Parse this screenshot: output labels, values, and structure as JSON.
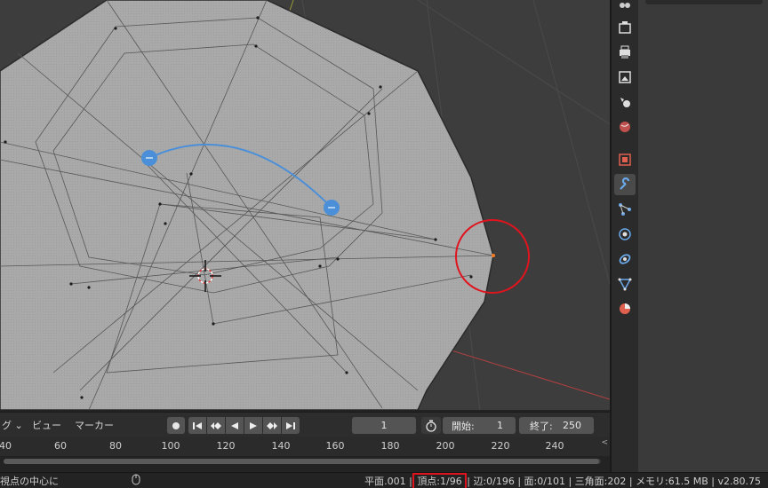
{
  "timeline": {
    "playback_menu": "グ",
    "view_menu": "ビュー",
    "marker_menu": "マーカー",
    "current_frame": "1",
    "start_label": "開始:",
    "start_value": "1",
    "end_label": "終了:",
    "end_value": "250",
    "ruler_ticks": [
      "40",
      "60",
      "80",
      "100",
      "120",
      "140",
      "160",
      "180",
      "200",
      "220",
      "240"
    ]
  },
  "status": {
    "hint_left": "視点の中心に",
    "object_name": "平面.001",
    "verts": "頂点:1/96",
    "edges": "辺:0/196",
    "faces": "面:0/101",
    "tris": "三角面:202",
    "memory": "メモリ:61.5 MB",
    "version": "v2.80.75"
  },
  "properties": {
    "tabs": [
      "tool",
      "render",
      "output",
      "view-layer",
      "scene",
      "world",
      "object",
      "modifiers",
      "particles",
      "physics",
      "constraints",
      "data",
      "material"
    ],
    "active_tab": "modifiers"
  },
  "colors": {
    "viewport_bg": "#3d3d3d",
    "mesh_fill": "#a8a8a8",
    "selection_circle": "#e0141e",
    "gizmo_blue": "#4a8fd8",
    "x_axis": "#b34040",
    "y_axis": "#9a9a3a"
  }
}
